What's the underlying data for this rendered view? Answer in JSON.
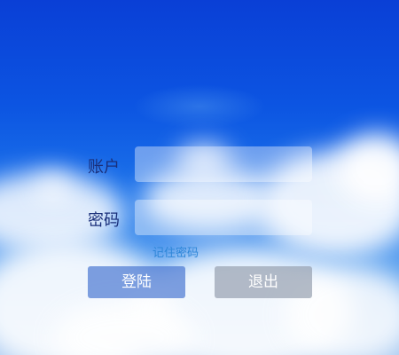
{
  "login": {
    "account_label": "账户",
    "password_label": "密码",
    "account_value": "",
    "password_value": "",
    "remember_password": "记住密码",
    "login_button": "登陆",
    "exit_button": "退出"
  },
  "colors": {
    "sky_top": "#0a3fd6",
    "label_text": "#1a2f7a",
    "link_text": "#2e86d8",
    "login_button_bg": "#4a78d2",
    "exit_button_bg": "#969faf"
  }
}
